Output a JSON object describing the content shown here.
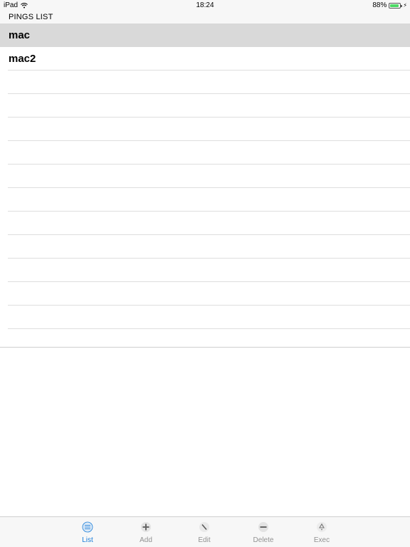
{
  "status_bar": {
    "carrier": "iPad",
    "time": "18:24",
    "battery_percent": "88%",
    "battery_level": 0.88
  },
  "header": {
    "title": "PINGS LIST"
  },
  "list": {
    "items": [
      {
        "label": "mac",
        "selected": true
      },
      {
        "label": "mac2",
        "selected": false
      }
    ],
    "empty_rows": 11
  },
  "tab_bar": {
    "tabs": [
      {
        "label": "List",
        "icon": "list-icon",
        "active": true
      },
      {
        "label": "Add",
        "icon": "plus-icon",
        "active": false
      },
      {
        "label": "Edit",
        "icon": "edit-icon",
        "active": false
      },
      {
        "label": "Delete",
        "icon": "minus-icon",
        "active": false
      },
      {
        "label": "Exec",
        "icon": "recycle-icon",
        "active": false
      }
    ]
  },
  "colors": {
    "accent": "#1a7ed9",
    "inactive": "#929292",
    "selected_row": "#d9d9d9",
    "battery": "#4cd964"
  }
}
